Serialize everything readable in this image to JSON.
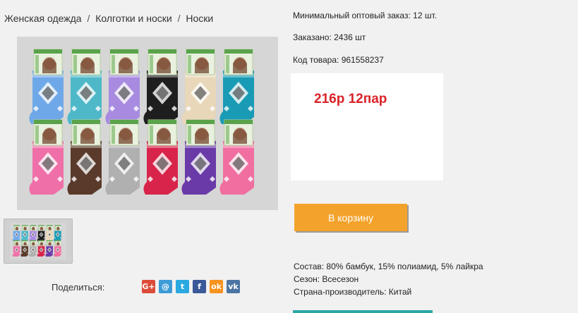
{
  "breadcrumb": [
    "Женская одежда",
    "Колготки и носки",
    "Носки"
  ],
  "breadcrumb_separator": "/",
  "info": {
    "min_order": "Минимальный оптовый заказ: 12 шт.",
    "ordered": "Заказано: 2436 шт",
    "sku": "Код товара: 961558237"
  },
  "price": "216р 12пар",
  "cart_button": "В корзину",
  "specs": {
    "composition": "Состав: 80% бамбук, 15% полиамид, 5% лайкра",
    "season": "Сезон: Всесезон",
    "country": "Страна-производитель: Китай"
  },
  "share": {
    "label": "Поделиться:",
    "icons": [
      {
        "name": "google-plus-icon",
        "glyph": "G+",
        "color": "#dd4b39"
      },
      {
        "name": "email-icon",
        "glyph": "@",
        "color": "#3d9bd6"
      },
      {
        "name": "twitter-icon",
        "glyph": "t",
        "color": "#2aa9e0"
      },
      {
        "name": "facebook-icon",
        "glyph": "f",
        "color": "#3b5998"
      },
      {
        "name": "odnoklassniki-icon",
        "glyph": "ok",
        "color": "#f7931e"
      },
      {
        "name": "vk-icon",
        "glyph": "vk",
        "color": "#4c75a3"
      }
    ]
  },
  "colors": {
    "price": "#d9232a",
    "cart_button": "#f3a32c",
    "bottom_bar": "#2aa7a7"
  },
  "sock_colors": {
    "top_row": [
      "#6fa8e8",
      "#4fb8c8",
      "#a88be0",
      "#1e1e1e",
      "#e8d7b8",
      "#1a9bb5"
    ],
    "bottom_row": [
      "#ef6fa8",
      "#5a3a2a",
      "#b0b0b0",
      "#d8244a",
      "#6a3aa8",
      "#f06fa0"
    ]
  }
}
